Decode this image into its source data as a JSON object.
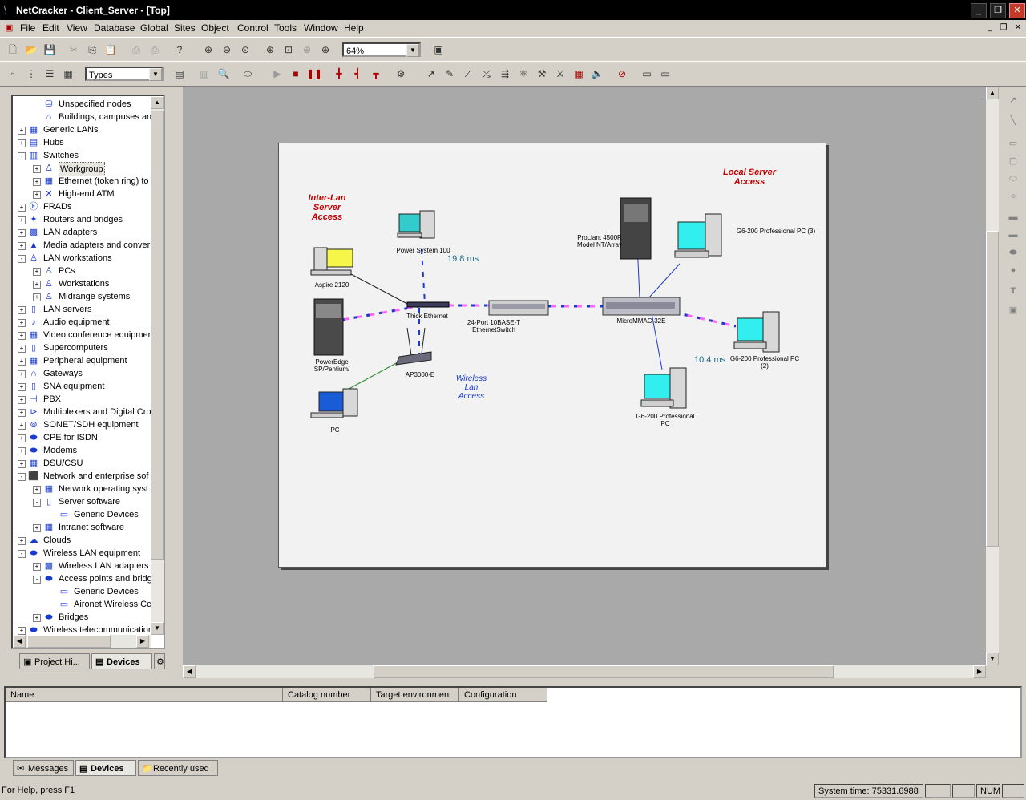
{
  "window": {
    "title": "NetCracker - Client_Server - [Top]"
  },
  "menu": [
    "File",
    "Edit",
    "View",
    "Database",
    "Global",
    "Sites",
    "Object",
    "Control",
    "Tools",
    "Window",
    "Help"
  ],
  "toolbar": {
    "zoom_value": "64%",
    "types_value": "Types"
  },
  "tree": [
    {
      "label": "Unspecified nodes",
      "level": 1,
      "exp": ""
    },
    {
      "label": "Buildings, campuses and LA",
      "level": 1,
      "exp": ""
    },
    {
      "label": "Generic LANs",
      "level": 0,
      "exp": "+"
    },
    {
      "label": "Hubs",
      "level": 0,
      "exp": "+"
    },
    {
      "label": "Switches",
      "level": 0,
      "exp": "-"
    },
    {
      "label": "Workgroup",
      "level": 1,
      "exp": "+",
      "selected": true
    },
    {
      "label": "Ethernet (token ring) to",
      "level": 1,
      "exp": "+"
    },
    {
      "label": "High-end ATM",
      "level": 1,
      "exp": "+"
    },
    {
      "label": "FRADs",
      "level": 0,
      "exp": "+"
    },
    {
      "label": "Routers and bridges",
      "level": 0,
      "exp": "+"
    },
    {
      "label": "LAN adapters",
      "level": 0,
      "exp": "+"
    },
    {
      "label": "Media adapters and conver",
      "level": 0,
      "exp": "+"
    },
    {
      "label": "LAN workstations",
      "level": 0,
      "exp": "-"
    },
    {
      "label": "PCs",
      "level": 1,
      "exp": "+"
    },
    {
      "label": "Workstations",
      "level": 1,
      "exp": "+"
    },
    {
      "label": "Midrange systems",
      "level": 1,
      "exp": "+"
    },
    {
      "label": "LAN servers",
      "level": 0,
      "exp": "+"
    },
    {
      "label": "Audio equipment",
      "level": 0,
      "exp": "+"
    },
    {
      "label": "Video conference equipmer",
      "level": 0,
      "exp": "+"
    },
    {
      "label": "Supercomputers",
      "level": 0,
      "exp": "+"
    },
    {
      "label": "Peripheral equipment",
      "level": 0,
      "exp": "+"
    },
    {
      "label": "Gateways",
      "level": 0,
      "exp": "+"
    },
    {
      "label": "SNA equipment",
      "level": 0,
      "exp": "+"
    },
    {
      "label": "PBX",
      "level": 0,
      "exp": "+"
    },
    {
      "label": "Multiplexers and Digital Cro",
      "level": 0,
      "exp": "+"
    },
    {
      "label": "SONET/SDH equipment",
      "level": 0,
      "exp": "+"
    },
    {
      "label": "CPE for ISDN",
      "level": 0,
      "exp": "+"
    },
    {
      "label": "Modems",
      "level": 0,
      "exp": "+"
    },
    {
      "label": "DSU/CSU",
      "level": 0,
      "exp": "+"
    },
    {
      "label": "Network and enterprise sof",
      "level": 0,
      "exp": "-"
    },
    {
      "label": "Network operating syst",
      "level": 1,
      "exp": "+"
    },
    {
      "label": "Server software",
      "level": 1,
      "exp": "-"
    },
    {
      "label": "Generic Devices",
      "level": 2,
      "exp": ""
    },
    {
      "label": "Intranet software",
      "level": 1,
      "exp": "+"
    },
    {
      "label": "Clouds",
      "level": 0,
      "exp": "+"
    },
    {
      "label": "Wireless LAN equipment",
      "level": 0,
      "exp": "-"
    },
    {
      "label": "Wireless LAN adapters",
      "level": 1,
      "exp": "+"
    },
    {
      "label": "Access points and bridg",
      "level": 1,
      "exp": "-"
    },
    {
      "label": "Generic Devices",
      "level": 2,
      "exp": ""
    },
    {
      "label": "Aironet Wireless Cc",
      "level": 2,
      "exp": ""
    },
    {
      "label": "Bridges",
      "level": 1,
      "exp": "+"
    },
    {
      "label": "Wireless telecommunication",
      "level": 0,
      "exp": "+"
    }
  ],
  "left_tabs": [
    "Project Hi...",
    "Devices"
  ],
  "diagram": {
    "regions": {
      "inter_lan": "Inter-Lan\nServer\nAccess",
      "local_server": "Local Server\nAccess",
      "wireless": "Wireless\nLan\nAccess"
    },
    "latency": [
      "19.8 ms",
      "10.4 ms"
    ],
    "devices": {
      "power_system": "Power System 100",
      "aspire": "Aspire 2120",
      "poweredge": "PowerEdge\nSP/Pentium/",
      "ap": "AP3000-E",
      "pc": "PC",
      "thick_ethernet": "Thick Ethernet",
      "switch24": "24-Port 10BASE-T\nEthernetSwitch",
      "proliant": "ProLiant 4500R\nModel NT/Array",
      "micrommac": "MicroMMAC-32E",
      "g6_3": "G6-200 Professional PC (3)",
      "g6_2": "G6-200 Professional PC\n(2)",
      "g6_1": "G6-200 Professional\nPC"
    }
  },
  "bottom": {
    "columns": [
      "Name",
      "Catalog number",
      "Target environment",
      "Configuration"
    ],
    "tabs": [
      "Messages",
      "Devices",
      "Recently used"
    ]
  },
  "status": {
    "help": "For Help, press F1",
    "time": "System time: 75331.6988",
    "num": "NUM"
  }
}
